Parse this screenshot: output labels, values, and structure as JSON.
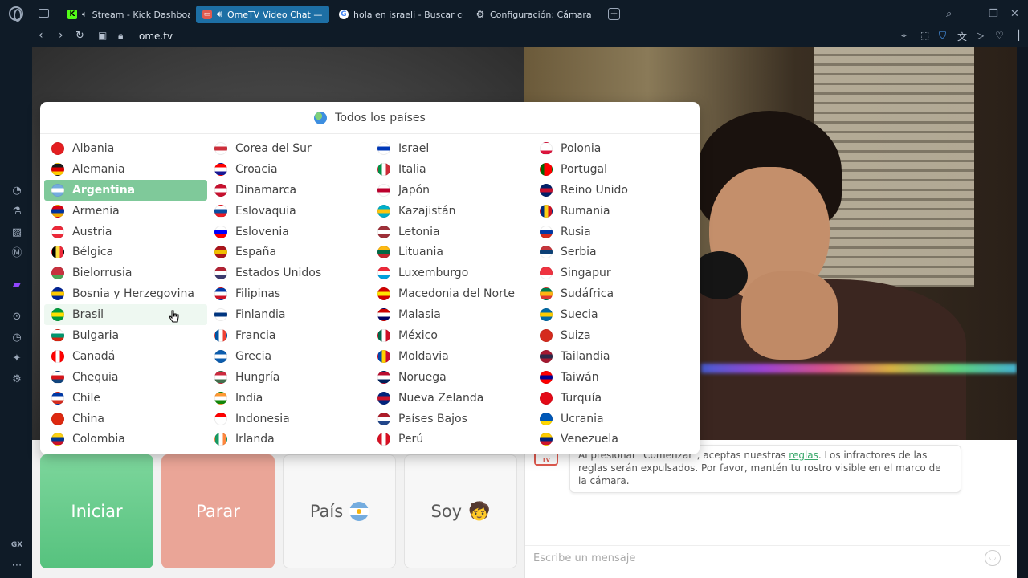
{
  "browser": {
    "tabs": [
      {
        "title": "Stream - Kick Dashboa",
        "icon": "kick-icon",
        "active": false
      },
      {
        "title": "OmeTV Video Chat —",
        "icon": "ometv-icon",
        "active": true
      },
      {
        "title": "hola en israeli - Buscar co",
        "icon": "google-icon",
        "active": false
      },
      {
        "title": "Configuración: Cámara",
        "icon": "gear-icon",
        "active": false
      }
    ],
    "new_tab": "+",
    "url": "ome.tv",
    "sidebar_badge": "GX"
  },
  "country_selector": {
    "header": "Todos los países",
    "selected": "Argentina",
    "hovered": "Brasil",
    "columns": [
      [
        {
          "name": "Albania",
          "flag": "#e41e20"
        },
        {
          "name": "Alemania",
          "flag": "#1a1a1a|#dd0000|#ffce00"
        },
        {
          "name": "Argentina",
          "flag": "#74acdf|#ffffff|#74acdf"
        },
        {
          "name": "Armenia",
          "flag": "#d90012|#0033a0|#f2a800"
        },
        {
          "name": "Austria",
          "flag": "#ed2939|#ffffff|#ed2939"
        },
        {
          "name": "Bélgica",
          "flag": "#000000|#fae042|#ed2939|v"
        },
        {
          "name": "Bielorrusia",
          "flag": "#c8313e|#c8313e|#4aa657"
        },
        {
          "name": "Bosnia y Herzegovina",
          "flag": "#002395|#fecb00|#002395"
        },
        {
          "name": "Brasil",
          "flag": "#009c3b|#ffdf00|#009c3b"
        },
        {
          "name": "Bulgaria",
          "flag": "#ffffff|#00966e|#d62612"
        },
        {
          "name": "Canadá",
          "flag": "#ff0000|#ffffff|#ff0000|v"
        },
        {
          "name": "Chequia",
          "flag": "#ffffff|#d7141a|#11457e"
        },
        {
          "name": "Chile",
          "flag": "#0039a6|#ffffff|#d52b1e"
        },
        {
          "name": "China",
          "flag": "#de2910"
        },
        {
          "name": "Colombia",
          "flag": "#fcd116|#003893|#ce1126"
        }
      ],
      [
        {
          "name": "Corea del Sur",
          "flag": "#ffffff|#cd2e3a|#ffffff"
        },
        {
          "name": "Croacia",
          "flag": "#ff0000|#ffffff|#171796"
        },
        {
          "name": "Dinamarca",
          "flag": "#c8102e|#ffffff|#c8102e"
        },
        {
          "name": "Eslovaquia",
          "flag": "#ffffff|#0b4ea2|#ee1c25"
        },
        {
          "name": "Eslovenia",
          "flag": "#ffffff|#0000ff|#ff0000"
        },
        {
          "name": "España",
          "flag": "#aa151b|#f1bf00|#aa151b"
        },
        {
          "name": "Estados Unidos",
          "flag": "#b22234|#ffffff|#3c3b6e"
        },
        {
          "name": "Filipinas",
          "flag": "#0038a8|#ffffff|#ce1126"
        },
        {
          "name": "Finlandia",
          "flag": "#ffffff|#003580|#ffffff"
        },
        {
          "name": "Francia",
          "flag": "#0055a4|#ffffff|#ef4135|v"
        },
        {
          "name": "Grecia",
          "flag": "#0d5eaf|#ffffff|#0d5eaf"
        },
        {
          "name": "Hungría",
          "flag": "#cd2a3e|#ffffff|#436f4d"
        },
        {
          "name": "India",
          "flag": "#ff9933|#ffffff|#138808"
        },
        {
          "name": "Indonesia",
          "flag": "#ff0000|#ffffff|#ffffff"
        },
        {
          "name": "Irlanda",
          "flag": "#169b62|#ffffff|#ff883e|v"
        }
      ],
      [
        {
          "name": "Israel",
          "flag": "#ffffff|#0038b8|#ffffff"
        },
        {
          "name": "Italia",
          "flag": "#009246|#ffffff|#ce2b37|v"
        },
        {
          "name": "Japón",
          "flag": "#ffffff|#bc002d|#ffffff"
        },
        {
          "name": "Kazajistán",
          "flag": "#00afca|#fec50c|#00afca"
        },
        {
          "name": "Letonia",
          "flag": "#9e3039|#ffffff|#9e3039"
        },
        {
          "name": "Lituania",
          "flag": "#fdb913|#006a44|#c1272d"
        },
        {
          "name": "Luxemburgo",
          "flag": "#ed2939|#ffffff|#00a1de"
        },
        {
          "name": "Macedonia del Norte",
          "flag": "#d20000|#ffe600|#d20000"
        },
        {
          "name": "Malasia",
          "flag": "#cc0001|#ffffff|#010066"
        },
        {
          "name": "México",
          "flag": "#006847|#ffffff|#ce1126|v"
        },
        {
          "name": "Moldavia",
          "flag": "#0046ae|#ffd200|#cc092f|v"
        },
        {
          "name": "Noruega",
          "flag": "#ba0c2f|#ffffff|#00205b"
        },
        {
          "name": "Nueva Zelanda",
          "flag": "#00247d|#cc142b|#00247d"
        },
        {
          "name": "Países Bajos",
          "flag": "#ae1c28|#ffffff|#21468b"
        },
        {
          "name": "Perú",
          "flag": "#d91023|#ffffff|#d91023|v"
        }
      ],
      [
        {
          "name": "Polonia",
          "flag": "#ffffff|#ffffff|#dc143c"
        },
        {
          "name": "Portugal",
          "flag": "#006600|#ff0000|#ff0000|v"
        },
        {
          "name": "Reino Unido",
          "flag": "#012169|#c8102e|#012169"
        },
        {
          "name": "Rumania",
          "flag": "#002b7f|#fcd116|#ce1126|v"
        },
        {
          "name": "Rusia",
          "flag": "#ffffff|#0039a6|#d52b1e"
        },
        {
          "name": "Serbia",
          "flag": "#c6363c|#0c4076|#ffffff"
        },
        {
          "name": "Singapur",
          "flag": "#ef3340|#ef3340|#ffffff"
        },
        {
          "name": "Sudáfrica",
          "flag": "#007a4d|#ffb612|#de3831"
        },
        {
          "name": "Suecia",
          "flag": "#006aa7|#fecc00|#006aa7"
        },
        {
          "name": "Suiza",
          "flag": "#d52b1e"
        },
        {
          "name": "Tailandia",
          "flag": "#a51931|#2d2a4a|#a51931"
        },
        {
          "name": "Taiwán",
          "flag": "#fe0000|#000095|#fe0000"
        },
        {
          "name": "Turquía",
          "flag": "#e30a17"
        },
        {
          "name": "Ucrania",
          "flag": "#0057b7|#0057b7|#ffd700"
        },
        {
          "name": "Venezuela",
          "flag": "#ffcc00|#00247d|#cf142b"
        }
      ]
    ]
  },
  "controls": {
    "start": "Iniciar",
    "stop": "Parar",
    "country": "País",
    "gender": "Soy",
    "gender_icon": "boy-emoji-icon",
    "gender_emoji": "🧒"
  },
  "chat": {
    "logo_text": "Ome TV",
    "message_before": "Al presionar \"Comenzar\", aceptas nuestras ",
    "message_link": "reglas",
    "message_after": ". Los infractores de las reglas serán expulsados. Por favor, mantén tu rostro visible en el marco de la cámara.",
    "input_placeholder": "Escribe un mensaje",
    "emoji_icon": "smile-icon"
  },
  "colors": {
    "browser_bg": "#0f1b27",
    "active_tab": "#1d6fa5",
    "start_green": "#56c27e",
    "stop_red": "#eaa597",
    "selected_row": "#7fc99a",
    "link_green": "#3aa86b"
  }
}
